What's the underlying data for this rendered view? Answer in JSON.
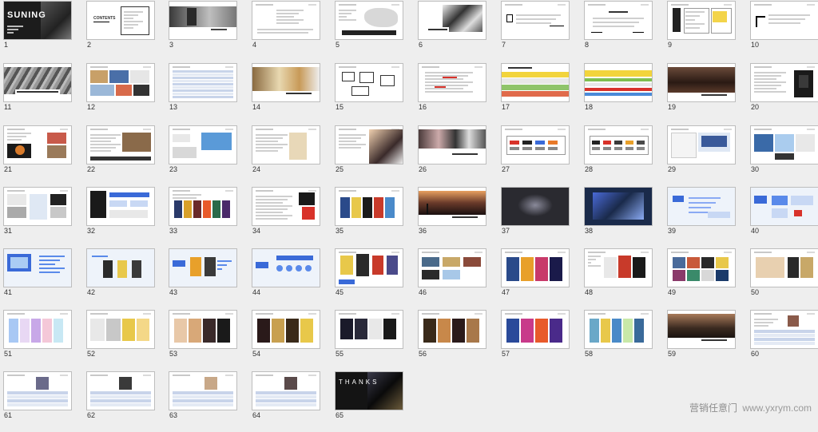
{
  "slides": [
    {
      "n": "1",
      "v": "cover-dark"
    },
    {
      "n": "2",
      "v": "contents"
    },
    {
      "n": "3",
      "v": "photo-left"
    },
    {
      "n": "4",
      "v": "text-doc"
    },
    {
      "n": "5",
      "v": "map"
    },
    {
      "n": "6",
      "v": "photo-bw"
    },
    {
      "n": "7",
      "v": "text-sparse"
    },
    {
      "n": "8",
      "v": "text-sparse2"
    },
    {
      "n": "9",
      "v": "boxes"
    },
    {
      "n": "10",
      "v": "text-letter"
    },
    {
      "n": "11",
      "v": "photo-wide"
    },
    {
      "n": "12",
      "v": "collage"
    },
    {
      "n": "13",
      "v": "table"
    },
    {
      "n": "14",
      "v": "photo-warm"
    },
    {
      "n": "15",
      "v": "flow"
    },
    {
      "n": "16",
      "v": "text-red"
    },
    {
      "n": "17",
      "v": "banner-yellow"
    },
    {
      "n": "18",
      "v": "banner-yellow2"
    },
    {
      "n": "19",
      "v": "photo-dusk"
    },
    {
      "n": "20",
      "v": "text-poster"
    },
    {
      "n": "21",
      "v": "collage2"
    },
    {
      "n": "22",
      "v": "text-img"
    },
    {
      "n": "23",
      "v": "collage3"
    },
    {
      "n": "24",
      "v": "text-img2"
    },
    {
      "n": "25",
      "v": "photo-man"
    },
    {
      "n": "26",
      "v": "photo-people"
    },
    {
      "n": "27",
      "v": "logos"
    },
    {
      "n": "28",
      "v": "logos2"
    },
    {
      "n": "29",
      "v": "web"
    },
    {
      "n": "30",
      "v": "web2"
    },
    {
      "n": "31",
      "v": "collage4"
    },
    {
      "n": "32",
      "v": "flow-dark"
    },
    {
      "n": "33",
      "v": "posters"
    },
    {
      "n": "34",
      "v": "text-poster2"
    },
    {
      "n": "35",
      "v": "posters2"
    },
    {
      "n": "36",
      "v": "photo-sunset"
    },
    {
      "n": "37",
      "v": "dark-stage"
    },
    {
      "n": "38",
      "v": "dark-blue"
    },
    {
      "n": "39",
      "v": "blue-chart"
    },
    {
      "n": "40",
      "v": "blue-chart2"
    },
    {
      "n": "41",
      "v": "blue-screen"
    },
    {
      "n": "42",
      "v": "blue-items"
    },
    {
      "n": "43",
      "v": "blue-items2"
    },
    {
      "n": "44",
      "v": "blue-diagram"
    },
    {
      "n": "45",
      "v": "posters3"
    },
    {
      "n": "46",
      "v": "collage5"
    },
    {
      "n": "47",
      "v": "posters4"
    },
    {
      "n": "48",
      "v": "posters5"
    },
    {
      "n": "49",
      "v": "posters6"
    },
    {
      "n": "50",
      "v": "posters7"
    },
    {
      "n": "51",
      "v": "posters8"
    },
    {
      "n": "52",
      "v": "posters9"
    },
    {
      "n": "53",
      "v": "posters10"
    },
    {
      "n": "54",
      "v": "posters11"
    },
    {
      "n": "55",
      "v": "posters12"
    },
    {
      "n": "56",
      "v": "posters13"
    },
    {
      "n": "57",
      "v": "posters14"
    },
    {
      "n": "58",
      "v": "posters15"
    },
    {
      "n": "59",
      "v": "photo-dusk2"
    },
    {
      "n": "60",
      "v": "profile"
    },
    {
      "n": "61",
      "v": "profile2"
    },
    {
      "n": "62",
      "v": "profile3"
    },
    {
      "n": "63",
      "v": "profile4"
    },
    {
      "n": "64",
      "v": "profile5"
    },
    {
      "n": "65",
      "v": "thanks"
    }
  ],
  "labels": {
    "cover": "SUNING",
    "contents": "CONTENTS",
    "thanks": "THANKS"
  },
  "watermark": {
    "cn": "营销任意门",
    "url": "www.yxrym.com"
  }
}
